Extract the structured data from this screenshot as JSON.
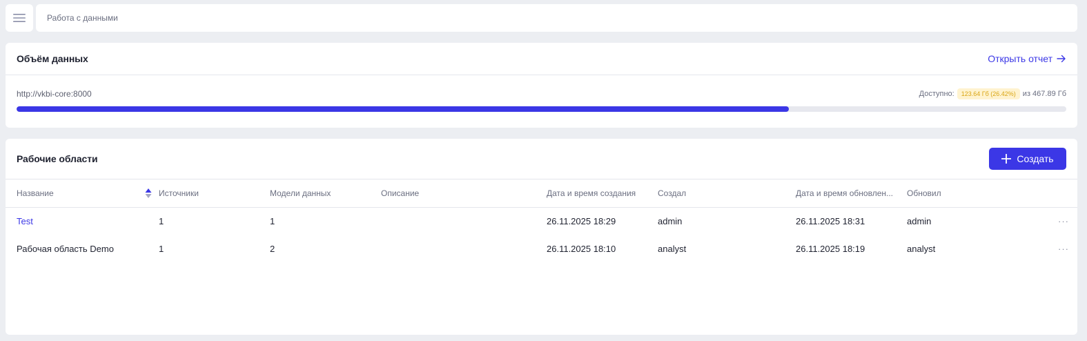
{
  "breadcrumb": "Работа с данными",
  "volume": {
    "title": "Объём данных",
    "open_report": "Открыть отчет",
    "url": "http://vkbi-core:8000",
    "available_label": "Доступно:",
    "available_value": "123.64 Гб (26.42%)",
    "total_text": "из 467.89 Гб",
    "used_fraction": 0.7358
  },
  "workspaces": {
    "title": "Рабочие области",
    "create_label": "Создать",
    "columns": [
      "Название",
      "Источники",
      "Модели данных",
      "Описание",
      "Дата и время создания",
      "Создал",
      "Дата и время обновлен...",
      "Обновил"
    ],
    "rows": [
      {
        "name": "Test",
        "sources": "1",
        "models": "1",
        "description": "",
        "created": "26.11.2025 18:29",
        "created_by": "admin",
        "updated": "26.11.2025 18:31",
        "updated_by": "admin"
      },
      {
        "name": "Рабочая область Demo",
        "sources": "1",
        "models": "2",
        "description": "",
        "created": "26.11.2025 18:10",
        "created_by": "analyst",
        "updated": "26.11.2025 18:19",
        "updated_by": "analyst"
      }
    ]
  },
  "colors": {
    "accent": "#3b37e6",
    "badge_bg": "#fff3cf",
    "badge_text": "#d9a514"
  },
  "icons": {
    "menu": "hamburger-icon",
    "arrow": "arrow-right-icon",
    "plus": "plus-icon",
    "sort": "sort-icon",
    "more": "more-horizontal-icon"
  }
}
